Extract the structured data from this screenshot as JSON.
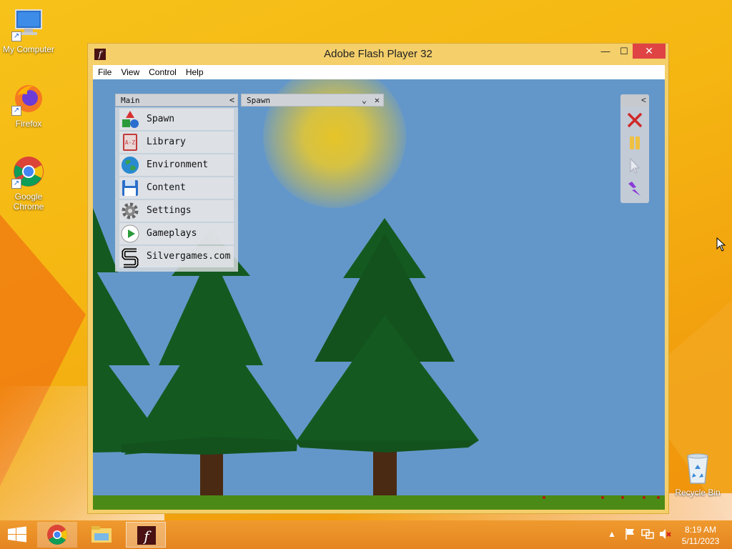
{
  "desktop": {
    "icons": [
      {
        "label": "My Computer"
      },
      {
        "label": "Firefox"
      },
      {
        "label": "Google Chrome"
      },
      {
        "label": "Recycle Bin"
      }
    ]
  },
  "window": {
    "title": "Adobe Flash Player 32",
    "controls": {
      "minimize": "—",
      "maximize": "☐",
      "close": "✕"
    },
    "menu": [
      "File",
      "View",
      "Control",
      "Help"
    ]
  },
  "game": {
    "main_panel": {
      "title": "Main",
      "collapse": "<",
      "items": [
        {
          "label": "Spawn",
          "icon": "spawn-icon"
        },
        {
          "label": "Library",
          "icon": "library-icon",
          "icon_text": "A-Z"
        },
        {
          "label": "Environment",
          "icon": "globe-icon"
        },
        {
          "label": "Content",
          "icon": "floppy-disk-icon"
        },
        {
          "label": "Settings",
          "icon": "gear-icon"
        },
        {
          "label": "Gameplays",
          "icon": "play-icon"
        },
        {
          "label": "Silvergames.com",
          "icon": "silvergames-logo-icon"
        }
      ]
    },
    "spawn_panel": {
      "title": "Spawn",
      "dropdown": "⌄",
      "close": "✕"
    },
    "tool_panel": {
      "collapse": "<",
      "tools": [
        "delete-tool-icon",
        "pause-icon",
        "pointer-tool-icon",
        "lightning-tool-icon"
      ]
    },
    "colors": {
      "sky": "#6497c9",
      "tree": "#145a20",
      "trunk": "#4a2a12",
      "ground": "#4b8a16",
      "sun": "#e6c428"
    }
  },
  "taskbar": {
    "apps": [
      "windows-start-icon",
      "chrome-icon",
      "file-explorer-icon",
      "flash-player-icon"
    ],
    "time": "8:19 AM",
    "date": "5/11/2023",
    "tray_arrow": "▲"
  }
}
